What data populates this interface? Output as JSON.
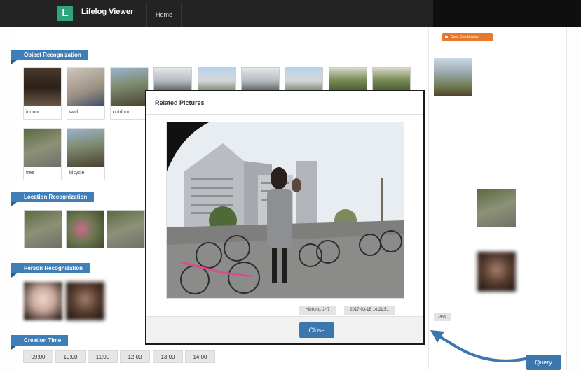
{
  "app": {
    "logo_letter": "L",
    "title": "Lifelog Viewer"
  },
  "nav": {
    "home": "Home"
  },
  "sections": {
    "object": "Object Recognization",
    "location": "Location Recognization",
    "person": "Person Recognization",
    "time": "Creation Time"
  },
  "object_thumbs": [
    {
      "label": "indoor"
    },
    {
      "label": "wall"
    },
    {
      "label": "outdoor"
    },
    {
      "label": "tree"
    },
    {
      "label": "bicycle"
    }
  ],
  "time_chips": [
    "09:00",
    "10:00",
    "11:00",
    "12:00",
    "13:00",
    "14:00"
  ],
  "right_panel": {
    "cues_button": "Cues Combination",
    "time_chip": "14:00"
  },
  "query_button": "Query",
  "modal": {
    "title": "Related Pictures",
    "location": "Hibikino, 2~7",
    "timestamp": "2017-03-18 14:21:51",
    "close_button": "Close"
  },
  "colors": {
    "accent_blue": "#3b76ad",
    "brand_green": "#2fa37a",
    "cues_orange": "#e8772e",
    "navbar": "#232323"
  }
}
